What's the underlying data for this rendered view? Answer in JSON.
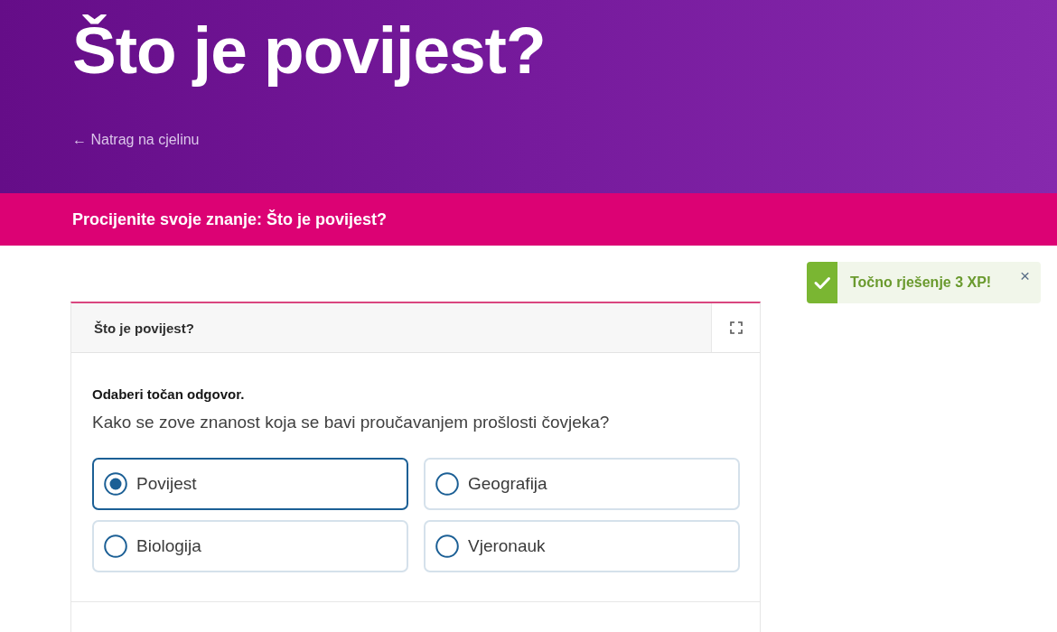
{
  "header": {
    "title": "Što je povijest?",
    "back_link": "← Natrag na cjelinu"
  },
  "banner": {
    "title": "Procijenite svoje znanje: Što je povijest?"
  },
  "toast": {
    "kind": "success",
    "message": "Točno rješenje 3 XP!",
    "close": "×"
  },
  "quiz_card": {
    "title": "Što je povijest?",
    "instruction": "Odaberi točan odgovor.",
    "question": "Kako se zove znanost koja se bavi proučavanjem prošlosti čovjeka?",
    "options": [
      {
        "label": "Povijest",
        "selected": true
      },
      {
        "label": "Geografija",
        "selected": false
      },
      {
        "label": "Biologija",
        "selected": false
      },
      {
        "label": "Vjeronauk",
        "selected": false
      }
    ]
  }
}
